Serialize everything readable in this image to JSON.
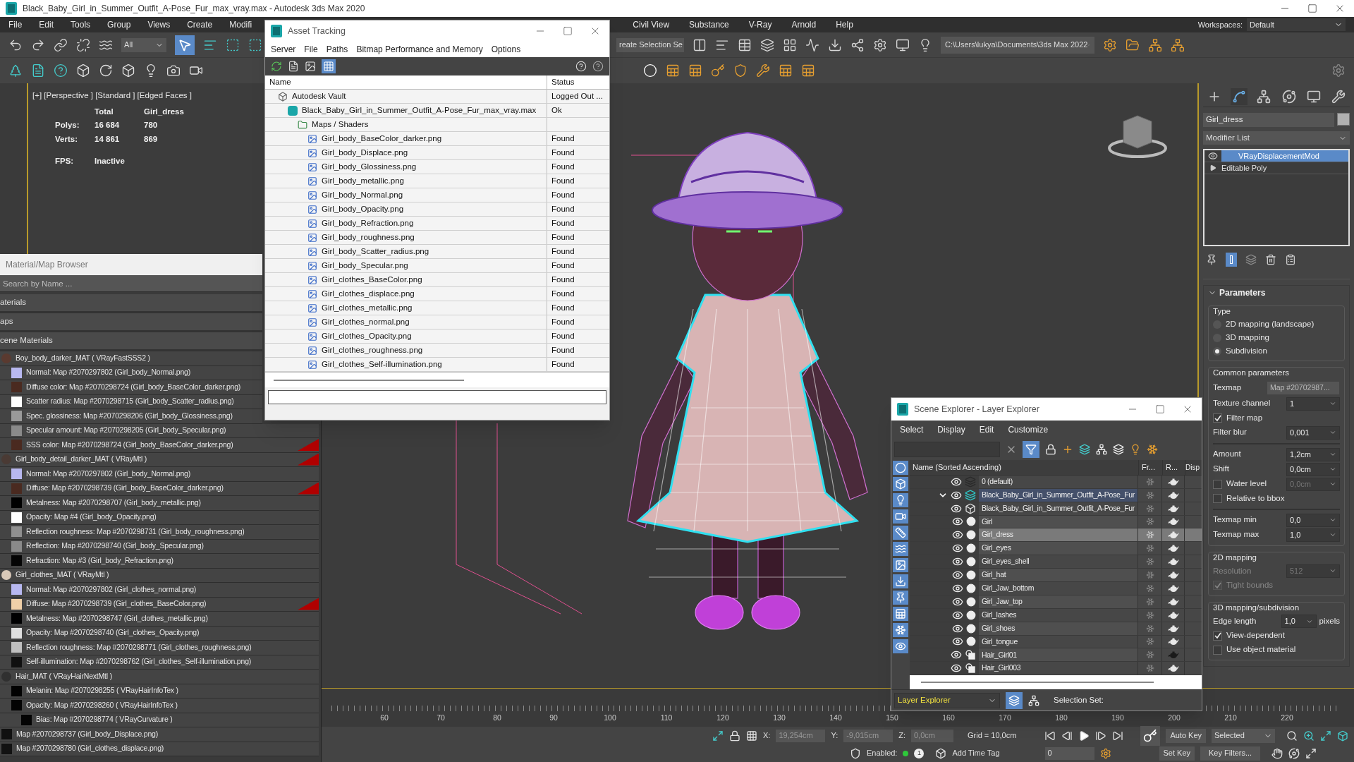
{
  "window": {
    "title": "Black_Baby_Girl_in_Summer_Outfit_A-Pose_Fur_max_vray.max - Autodesk 3ds Max 2020"
  },
  "menu": [
    "File",
    "Edit",
    "Tools",
    "Group",
    "Views",
    "Create",
    "Modifi"
  ],
  "menu_right": [
    "Civil View",
    "Substance",
    "V-Ray",
    "Arnold",
    "Help"
  ],
  "workspaces": {
    "label": "Workspaces:",
    "value": "Default"
  },
  "toolbar": {
    "selection_filter": "All",
    "named_selection": "reate Selection Se",
    "project_path": "C:\\Users\\lukya\\Documents\\3ds Max 2022"
  },
  "viewport": {
    "label": "[+] [Perspective ] [Standard ] [Edged Faces ]",
    "stats": {
      "header": [
        "Total",
        "Girl_dress"
      ],
      "rows": [
        {
          "label": "Polys:",
          "total": "16 684",
          "selection": "780"
        },
        {
          "label": "Verts:",
          "total": "14 861",
          "selection": "869"
        }
      ],
      "fps_label": "FPS:",
      "fps": "Inactive"
    }
  },
  "asset_tracking": {
    "title": "Asset Tracking",
    "menu": [
      "Server",
      "File",
      "Paths",
      "Bitmap Performance and Memory",
      "Options"
    ],
    "columns": [
      "Name",
      "Status"
    ],
    "items": [
      {
        "kind": "vault",
        "name": "Autodesk Vault",
        "status": "Logged Out ...",
        "children": [
          {
            "kind": "scene",
            "name": "Black_Baby_Girl_in_Summer_Outfit_A-Pose_Fur_max_vray.max",
            "status": "Ok",
            "children": [
              {
                "kind": "folder",
                "name": "Maps / Shaders",
                "children": [
                  {
                    "kind": "bitmap",
                    "name": "Girl_body_BaseColor_darker.png",
                    "status": "Found"
                  },
                  {
                    "kind": "bitmap",
                    "name": "Girl_body_Displace.png",
                    "status": "Found"
                  },
                  {
                    "kind": "bitmap",
                    "name": "Girl_body_Glossiness.png",
                    "status": "Found"
                  },
                  {
                    "kind": "bitmap",
                    "name": "Girl_body_metallic.png",
                    "status": "Found"
                  },
                  {
                    "kind": "bitmap",
                    "name": "Girl_body_Normal.png",
                    "status": "Found"
                  },
                  {
                    "kind": "bitmap",
                    "name": "Girl_body_Opacity.png",
                    "status": "Found"
                  },
                  {
                    "kind": "bitmap",
                    "name": "Girl_body_Refraction.png",
                    "status": "Found"
                  },
                  {
                    "kind": "bitmap",
                    "name": "Girl_body_roughness.png",
                    "status": "Found"
                  },
                  {
                    "kind": "bitmap",
                    "name": "Girl_body_Scatter_radius.png",
                    "status": "Found"
                  },
                  {
                    "kind": "bitmap",
                    "name": "Girl_body_Specular.png",
                    "status": "Found"
                  },
                  {
                    "kind": "bitmap",
                    "name": "Girl_clothes_BaseColor.png",
                    "status": "Found"
                  },
                  {
                    "kind": "bitmap",
                    "name": "Girl_clothes_displace.png",
                    "status": "Found"
                  },
                  {
                    "kind": "bitmap",
                    "name": "Girl_clothes_metallic.png",
                    "status": "Found"
                  },
                  {
                    "kind": "bitmap",
                    "name": "Girl_clothes_normal.png",
                    "status": "Found"
                  },
                  {
                    "kind": "bitmap",
                    "name": "Girl_clothes_Opacity.png",
                    "status": "Found"
                  },
                  {
                    "kind": "bitmap",
                    "name": "Girl_clothes_roughness.png",
                    "status": "Found"
                  },
                  {
                    "kind": "bitmap",
                    "name": "Girl_clothes_Self-illumination.png",
                    "status": "Found"
                  }
                ]
              }
            ]
          }
        ]
      }
    ]
  },
  "material_browser": {
    "title": "Material/Map Browser",
    "search_placeholder": "Search by Name ...",
    "sections": [
      "aterials",
      "aps",
      "cene Materials"
    ],
    "items": [
      {
        "kind": "material",
        "label": "Boy_body_darker_MAT  ( VRayFastSSS2 )",
        "color": "#5a3a30",
        "flagged": false,
        "children": [
          {
            "kind": "map",
            "label": "Normal: Map #2070297802 (Girl_body_Normal.png)",
            "color": "#b8b8f0",
            "flagged": false
          },
          {
            "kind": "map",
            "label": "Diffuse color: Map #2070298724 (Girl_body_BaseColor_darker.png)",
            "color": "#4a2a20",
            "flagged": false
          },
          {
            "kind": "map",
            "label": "Scatter radius: Map #2070298715 (Girl_body_Scatter_radius.png)",
            "color": "#ffffff",
            "flagged": false
          },
          {
            "kind": "map",
            "label": "Spec. glossiness: Map #2070298206 (Girl_body_Glossiness.png)",
            "color": "#9a9a9a",
            "flagged": false
          },
          {
            "kind": "map",
            "label": "Specular amount: Map #2070298205 (Girl_body_Specular.png)",
            "color": "#8a8a8a",
            "flagged": false
          },
          {
            "kind": "map",
            "label": "SSS color: Map #2070298724 (Girl_body_BaseColor_darker.png)",
            "color": "#4a2a20",
            "flagged": true
          }
        ]
      },
      {
        "kind": "material",
        "label": "Girl_body_detail_darker_MAT  ( VRayMtl )",
        "color": "#4a3a34",
        "flagged": true,
        "children": [
          {
            "kind": "map",
            "label": "Normal: Map #2070297802 (Girl_body_Normal.png)",
            "color": "#b8b8f0",
            "flagged": false
          },
          {
            "kind": "map",
            "label": "Diffuse: Map #2070298739 (Girl_body_BaseColor_darker.png)",
            "color": "#4a2a20",
            "flagged": true
          },
          {
            "kind": "map",
            "label": "Metalness: Map #2070298707 (Girl_body_metallic.png)",
            "color": "#000000",
            "flagged": false
          },
          {
            "kind": "map",
            "label": "Opacity: Map #4 (Girl_body_Opacity.png)",
            "color": "#ffffff",
            "flagged": false
          },
          {
            "kind": "map",
            "label": "Reflection roughness: Map #2070298731 (Girl_body_roughness.png)",
            "color": "#909090",
            "flagged": false
          },
          {
            "kind": "map",
            "label": "Reflection: Map #2070298740 (Girl_body_Specular.png)",
            "color": "#8a8a8a",
            "flagged": false
          },
          {
            "kind": "map",
            "label": "Refraction: Map #3 (Girl_body_Refraction.png)",
            "color": "#050505",
            "flagged": false
          }
        ]
      },
      {
        "kind": "material",
        "label": "Girl_clothes_MAT  ( VRayMtl )",
        "color": "#d8c8b8",
        "flagged": false,
        "children": [
          {
            "kind": "map",
            "label": "Normal: Map #2070297802 (Girl_clothes_normal.png)",
            "color": "#b8b8f0",
            "flagged": false
          },
          {
            "kind": "map",
            "label": "Diffuse: Map #2070298739 (Girl_clothes_BaseColor.png)",
            "color": "#f0d0a8",
            "flagged": true
          },
          {
            "kind": "map",
            "label": "Metalness: Map #2070298747 (Girl_clothes_metallic.png)",
            "color": "#000001",
            "flagged": false
          },
          {
            "kind": "map",
            "label": "Opacity: Map #2070298740 (Girl_clothes_Opacity.png)",
            "color": "#e0e0e0",
            "flagged": false
          },
          {
            "kind": "map",
            "label": "Reflection roughness: Map #2070298771 (Girl_clothes_roughness.png)",
            "color": "#c0c0c0",
            "flagged": false
          },
          {
            "kind": "map",
            "label": "Self-illumination: Map #2070298762 (Girl_clothes_Self-illumination.png)",
            "color": "#101010",
            "flagged": false
          }
        ]
      },
      {
        "kind": "material",
        "label": "Hair_MAT  ( VRayHairNextMtl )",
        "color": "#303030",
        "flagged": false,
        "children": [
          {
            "kind": "map",
            "label": "Melanin: Map #2070298255  ( VRayHairInfoTex )",
            "color": "#020202",
            "flagged": false
          },
          {
            "kind": "map",
            "label": "Opacity: Map #2070298260  ( VRayHairInfoTex )",
            "color": "#030303",
            "flagged": false,
            "children": [
              {
                "kind": "map",
                "label": "Bias: Map #2070298774  ( VRayCurvature )",
                "color": "#040404",
                "flagged": false
              }
            ]
          }
        ]
      },
      {
        "kind": "map",
        "label": "Map #2070298737 (Girl_body_Displace.png)",
        "color": "#111111",
        "flagged": false
      },
      {
        "kind": "map",
        "label": "Map #2070298780 (Girl_clothes_displace.png)",
        "color": "#121212",
        "flagged": false
      }
    ]
  },
  "scene_explorer": {
    "title": "Scene Explorer - Layer Explorer",
    "menu": [
      "Select",
      "Display",
      "Edit",
      "Customize"
    ],
    "columns": [
      "Name (Sorted Ascending)",
      "Fr...",
      "R...",
      "Disp"
    ],
    "rows": [
      {
        "kind": "layer",
        "name": "0 (default)",
        "selected": false,
        "current": false,
        "renderable": true
      },
      {
        "kind": "layer",
        "name": "Black_Baby_Girl_in_Summer_Outfit_A-Pose_Fur",
        "selected": false,
        "current": true,
        "expanded": true,
        "renderable": true,
        "children": [
          {
            "kind": "group",
            "name": "Black_Baby_Girl_in_Summer_Outfit_A-Pose_Fur",
            "selected": false,
            "current": false,
            "renderable": true
          },
          {
            "kind": "object",
            "name": "Girl",
            "selected": false,
            "current": false,
            "renderable": true
          },
          {
            "kind": "object",
            "name": "Girl_dress",
            "selected": true,
            "current": false,
            "renderable": true
          },
          {
            "kind": "object",
            "name": "Girl_eyes",
            "selected": false,
            "current": false,
            "renderable": true
          },
          {
            "kind": "object",
            "name": "Girl_eyes_shell",
            "selected": false,
            "current": false,
            "renderable": true
          },
          {
            "kind": "object",
            "name": "Girl_hat",
            "selected": false,
            "current": false,
            "renderable": true
          },
          {
            "kind": "object",
            "name": "Girl_Jaw_bottom",
            "selected": false,
            "current": false,
            "renderable": true
          },
          {
            "kind": "object",
            "name": "Girl_Jaw_top",
            "selected": false,
            "current": false,
            "renderable": true
          },
          {
            "kind": "object",
            "name": "Girl_lashes",
            "selected": false,
            "current": false,
            "renderable": true
          },
          {
            "kind": "object",
            "name": "Girl_shoes",
            "selected": false,
            "current": false,
            "renderable": true
          },
          {
            "kind": "object",
            "name": "Girl_tongue",
            "selected": false,
            "current": false,
            "renderable": true
          },
          {
            "kind": "hair",
            "name": "Hair_Girl01",
            "selected": false,
            "current": false,
            "renderable": false
          },
          {
            "kind": "hair",
            "name": "Hair_Girl003",
            "selected": false,
            "current": false,
            "renderable": true
          }
        ]
      }
    ],
    "explorer_type": "Layer Explorer",
    "selection_set_label": "Selection Set:"
  },
  "command_panel": {
    "tabs": [
      {
        "kind": "create",
        "selected": false
      },
      {
        "kind": "modify",
        "selected": true
      },
      {
        "kind": "hierarchy",
        "selected": false
      },
      {
        "kind": "motion",
        "selected": false
      },
      {
        "kind": "display",
        "selected": false
      },
      {
        "kind": "utilities",
        "selected": false
      }
    ],
    "object_name": "Girl_dress",
    "modifier_list": "Modifier List",
    "stack": [
      {
        "kind": "modifier",
        "name": "VRayDisplacementMod",
        "selected": true
      },
      {
        "kind": "base",
        "name": "Editable Poly",
        "selected": false
      }
    ],
    "rollout": {
      "title": "Parameters",
      "type_group": {
        "title": "Type",
        "options": [
          {
            "label": "2D mapping (landscape)",
            "selected": false
          },
          {
            "label": "3D mapping",
            "selected": false
          },
          {
            "label": "Subdivision",
            "selected": true
          }
        ]
      },
      "common": {
        "title": "Common parameters",
        "sections": [
          [
            {
              "kind": "map_button",
              "label": "Texmap",
              "value": "Map #20702987..."
            },
            {
              "kind": "spinner",
              "label": "Texture channel",
              "value": "1",
              "disabled": false
            },
            {
              "kind": "checkbox",
              "label": "Filter map",
              "checked": true,
              "disabled": false
            },
            {
              "kind": "spinner",
              "label": "Filter blur",
              "value": "0,001",
              "disabled": false
            }
          ],
          [
            {
              "kind": "spinner",
              "label": "Amount",
              "value": "1,2cm",
              "disabled": false
            },
            {
              "kind": "spinner",
              "label": "Shift",
              "value": "0,0cm",
              "disabled": false
            },
            {
              "kind": "checkbox_spinner",
              "label": "Water level",
              "checked": false,
              "value": "0,0cm",
              "disabled": true
            },
            {
              "kind": "checkbox",
              "label": "Relative to bbox",
              "checked": false,
              "disabled": false
            }
          ],
          [
            {
              "kind": "spinner",
              "label": "Texmap min",
              "value": "0,0",
              "disabled": false
            },
            {
              "kind": "spinner",
              "label": "Texmap max",
              "value": "1,0",
              "disabled": false
            }
          ]
        ]
      },
      "mapping_2d": {
        "title": "2D mapping",
        "rows": [
          {
            "kind": "spinner",
            "label": "Resolution",
            "value": "512",
            "disabled": true
          },
          {
            "kind": "checkbox",
            "label": "Tight bounds",
            "checked": true,
            "disabled": true
          }
        ]
      },
      "mapping_3d": {
        "title": "3D mapping/subdivision",
        "rows": [
          {
            "kind": "spinner_unit",
            "label": "Edge length",
            "value": "1,0",
            "unit": "pixels",
            "disabled": false
          },
          {
            "kind": "checkbox",
            "label": "View-dependent",
            "checked": true,
            "disabled": false
          },
          {
            "kind": "checkbox",
            "label": "Use object material",
            "checked": false,
            "disabled": false
          }
        ]
      }
    }
  },
  "timeline": {
    "ticks": [
      "60",
      "70",
      "80",
      "90",
      "100",
      "110",
      "120",
      "130",
      "140",
      "150",
      "160",
      "170",
      "180",
      "190",
      "200",
      "210",
      "220"
    ]
  },
  "status_bar": {
    "x": {
      "label": "X:",
      "value": "19,254cm"
    },
    "y": {
      "label": "Y:",
      "value": "-9,015cm"
    },
    "z": {
      "label": "Z:",
      "value": "0,0cm"
    },
    "grid": "Grid = 10,0cm",
    "enabled": "Enabled:",
    "badge": "1",
    "time_tag": "Add Time Tag",
    "frame": "0",
    "auto_key": "Auto Key",
    "key_mode": "Selected",
    "set_key": "Set Key",
    "key_filters": "Key Filters..."
  }
}
